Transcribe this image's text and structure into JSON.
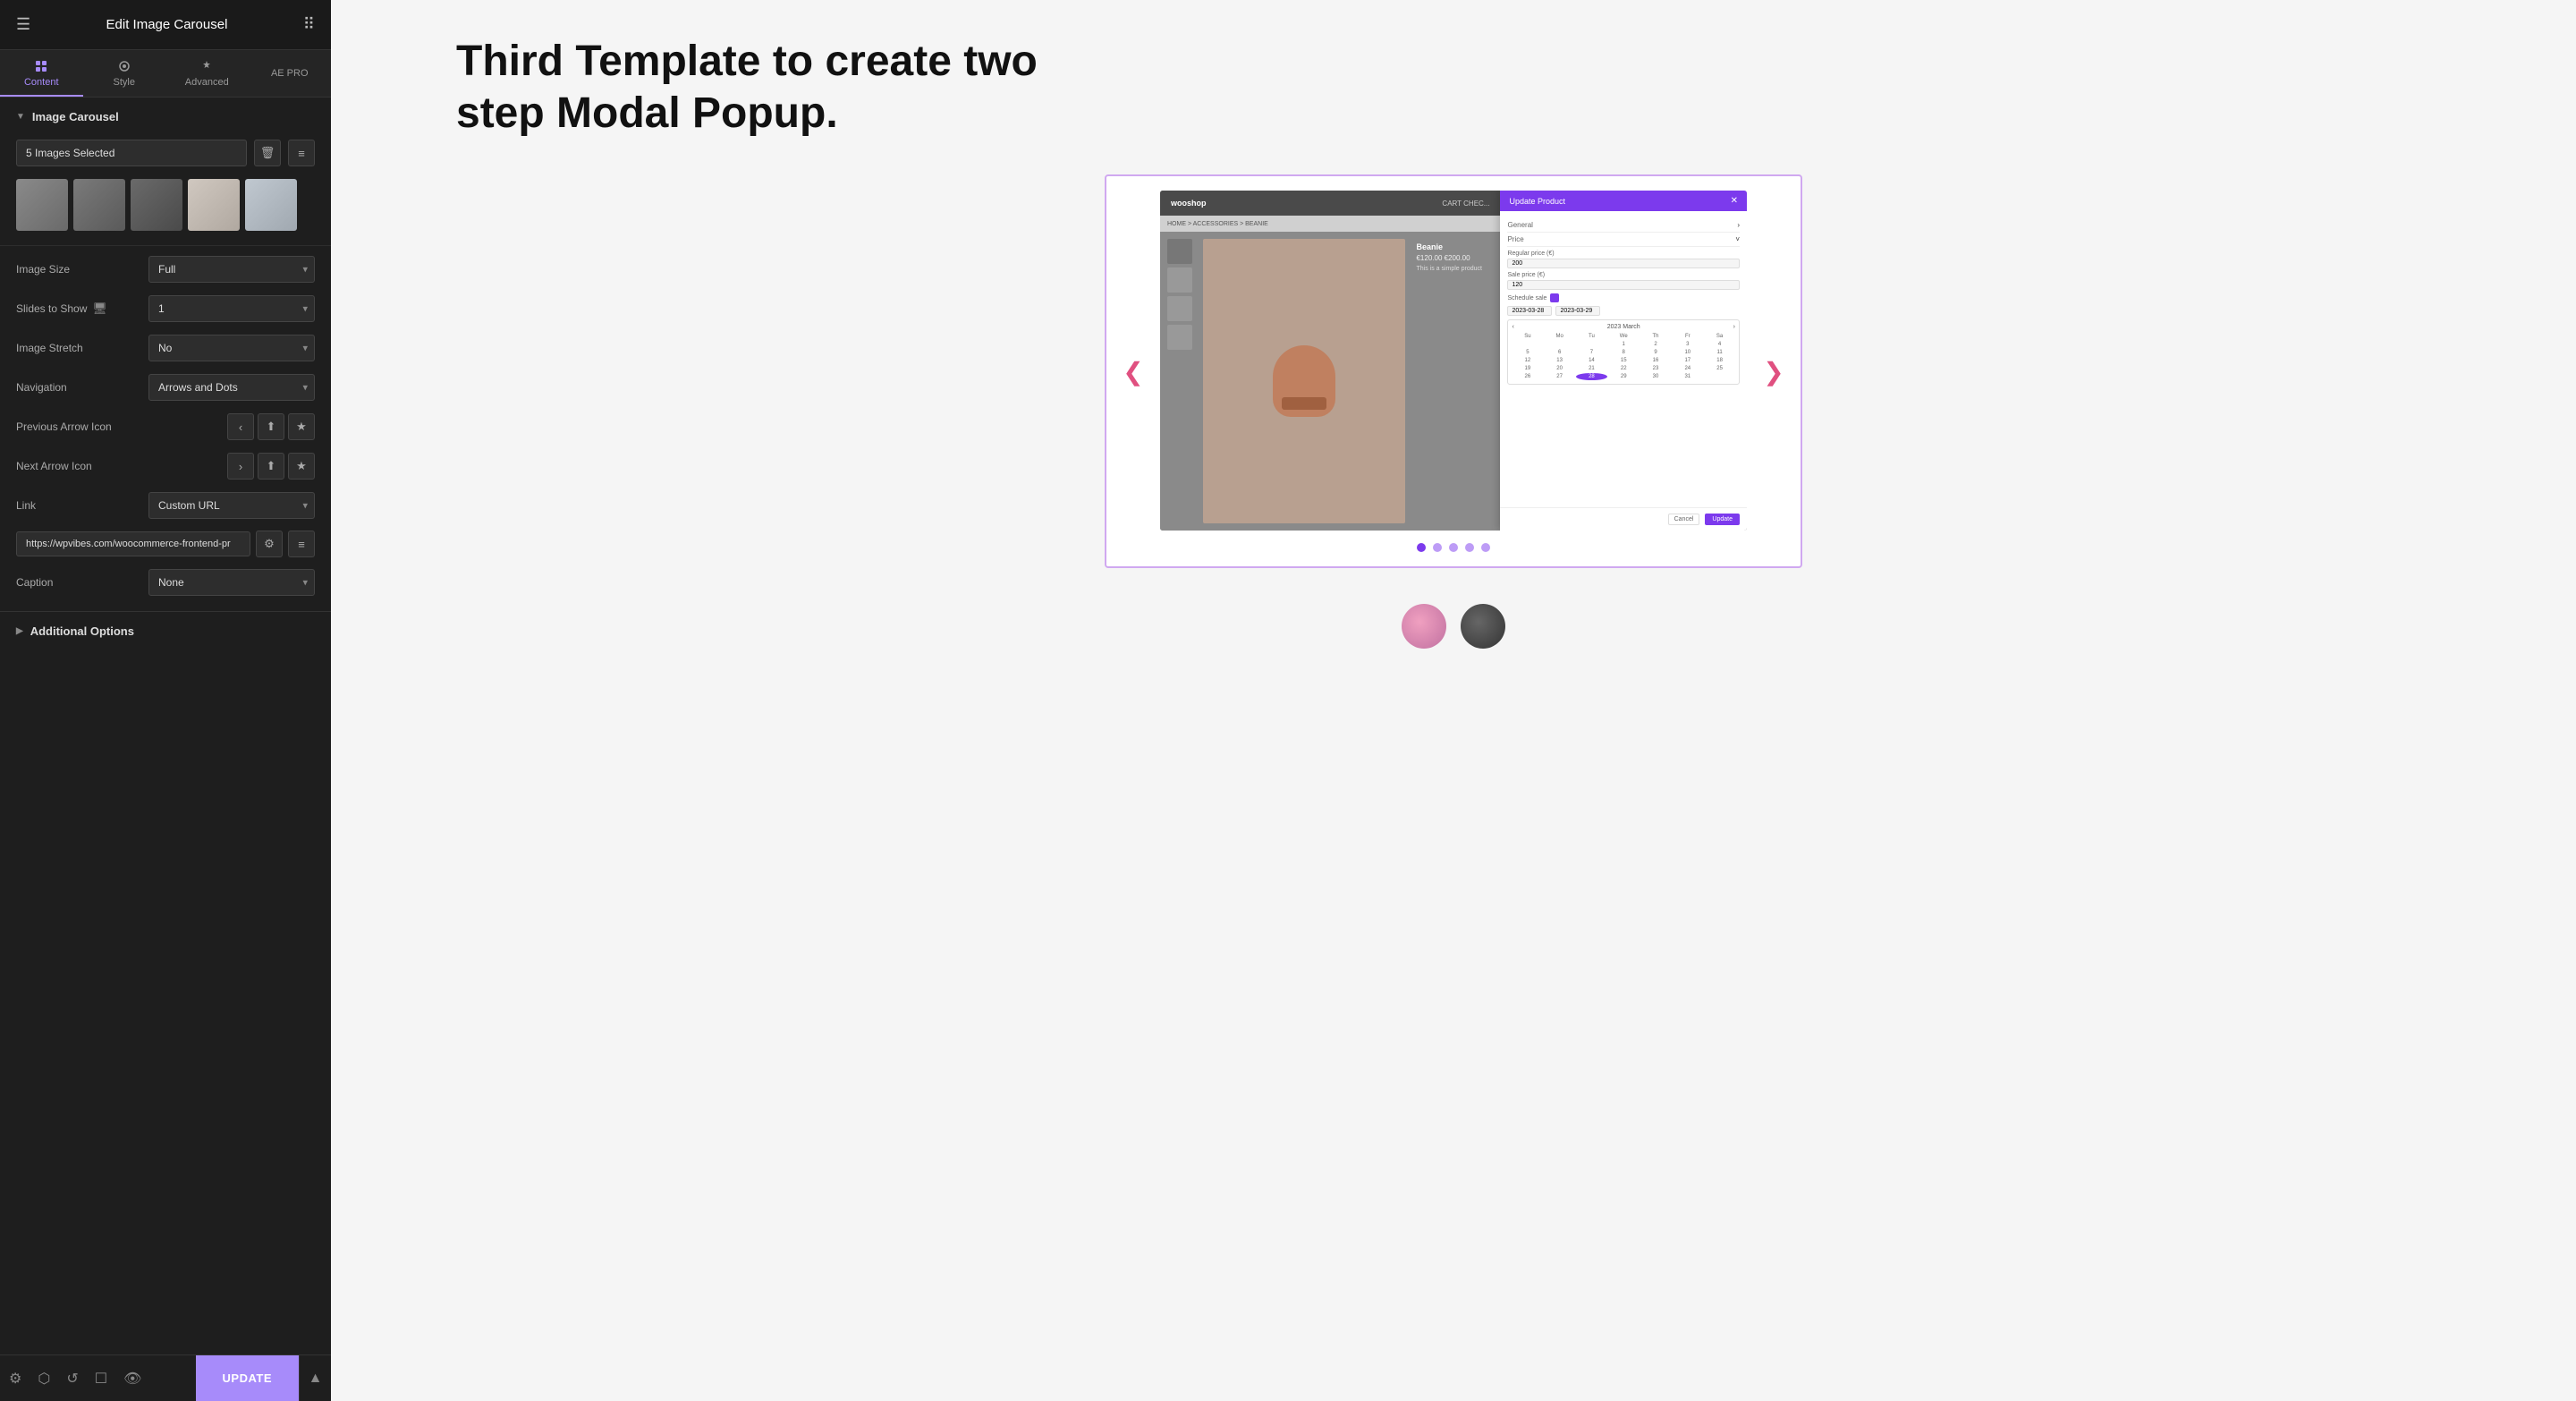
{
  "header": {
    "title": "Edit Image Carousel",
    "hamburger": "☰",
    "grid": "⋮⋮"
  },
  "tabs": [
    {
      "id": "content",
      "label": "Content",
      "active": true
    },
    {
      "id": "style",
      "label": "Style",
      "active": false
    },
    {
      "id": "advanced",
      "label": "Advanced",
      "active": false
    },
    {
      "id": "aepro",
      "label": "AE PRO",
      "active": false
    }
  ],
  "section": {
    "label": "Image Carousel",
    "images_selected": "5 Images Selected",
    "image_size_label": "Image Size",
    "image_size_value": "Full",
    "slides_to_show_label": "Slides to Show",
    "slides_to_show_value": "1",
    "image_stretch_label": "Image Stretch",
    "image_stretch_value": "No",
    "navigation_label": "Navigation",
    "navigation_value": "Arrows and Dots",
    "prev_arrow_label": "Previous Arrow Icon",
    "next_arrow_label": "Next Arrow Icon",
    "link_label": "Link",
    "link_value": "Custom URL",
    "url_value": "https://wpvibes.com/woocommerce-frontend-pr",
    "caption_label": "Caption",
    "caption_value": "None",
    "additional_options_label": "Additional Options"
  },
  "carousel": {
    "prev_arrow": "❮",
    "next_arrow": "❯",
    "dots_count": 5,
    "active_dot": 0
  },
  "main": {
    "title": "Third Template to create two step Modal Popup."
  },
  "modal": {
    "title": "Update Product",
    "general_label": "General",
    "price_label": "Price",
    "regular_price_label": "Regular price (€)",
    "regular_price_value": "200",
    "sale_price_label": "Sale price (€)",
    "sale_price_value": "120",
    "schedule_label": "Schedule sale",
    "date_from": "2023-03-28",
    "date_to": "2023-03-29",
    "cal_month": "2023  March",
    "cancel_label": "Cancel",
    "update_label": "Update"
  },
  "bottom_bar": {
    "update_label": "UPDATE"
  }
}
